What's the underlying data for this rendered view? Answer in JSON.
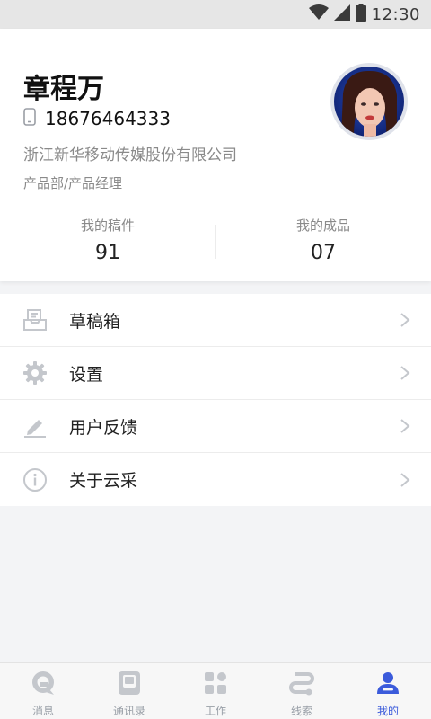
{
  "status_bar": {
    "time": "12:30"
  },
  "profile": {
    "name": "章程万",
    "phone": "18676464333",
    "company": "浙江新华移动传媒股份有限公司",
    "department": "产品部/产品经理",
    "stats": [
      {
        "label": "我的稿件",
        "value": "91"
      },
      {
        "label": "我的成品",
        "value": "07"
      }
    ]
  },
  "menu": {
    "items": [
      {
        "label": "草稿箱",
        "icon": "drafts-box-icon"
      },
      {
        "label": "设置",
        "icon": "gear-icon"
      },
      {
        "label": "用户反馈",
        "icon": "edit-feedback-icon"
      },
      {
        "label": "关于云采",
        "icon": "info-icon"
      }
    ]
  },
  "bottom_nav": {
    "items": [
      {
        "label": "消息",
        "icon": "message-icon",
        "active": false
      },
      {
        "label": "通讯录",
        "icon": "contacts-icon",
        "active": false
      },
      {
        "label": "工作",
        "icon": "work-grid-icon",
        "active": false
      },
      {
        "label": "线索",
        "icon": "clue-route-icon",
        "active": false
      },
      {
        "label": "我的",
        "icon": "person-icon",
        "active": true
      }
    ]
  },
  "colors": {
    "accent": "#3b5bdb",
    "icon_gray": "#c4c7cc",
    "text_secondary": "#8a8a8a"
  }
}
